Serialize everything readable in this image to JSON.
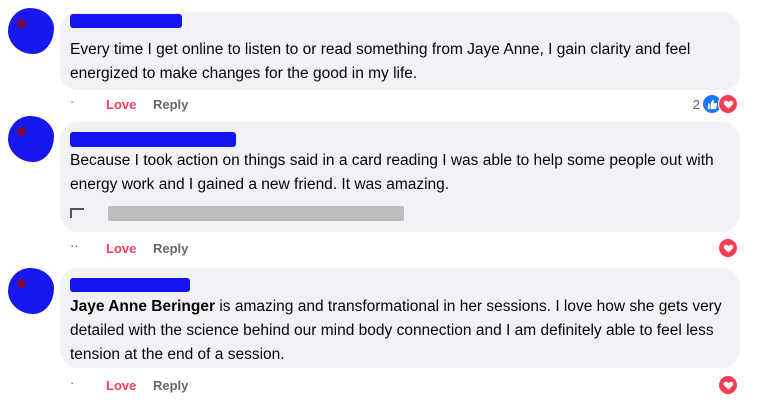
{
  "comments": [
    {
      "author": "",
      "text_prefix": "",
      "text": "Every time I get online to listen to or read something from Jaye Anne, I gain clarity and feel energized to make changes for the good in my life.",
      "actions": {
        "time": "·",
        "love": "Love",
        "reply": "Reply"
      },
      "reactions": {
        "count": "2",
        "icons": [
          "like-icon",
          "heart-icon"
        ]
      }
    },
    {
      "author": "",
      "text_prefix": "",
      "text": "Because I took action on things said in a card reading I was able to help some people out with energy work and I gained a new friend. It was amazing.",
      "actions": {
        "time": "··",
        "love": "Love",
        "reply": "Reply"
      },
      "reactions": {
        "count": "",
        "icons": [
          "heart-icon"
        ]
      }
    },
    {
      "author": "",
      "text_prefix": "Jaye Anne Beringer",
      "text": " is amazing and transformational in her sessions. I love how she gets very detailed with the science behind our mind body connection and I am definitely able to feel less tension at the end of a session.",
      "actions": {
        "time": "·",
        "love": "Love",
        "reply": "Reply"
      },
      "reactions": {
        "count": "",
        "icons": [
          "heart-icon"
        ]
      }
    }
  ],
  "colors": {
    "bubble": "#f0f2f5",
    "love": "#f33e58",
    "like": "#1877f2",
    "muted": "#65676b",
    "redaction": "#1414f0"
  }
}
